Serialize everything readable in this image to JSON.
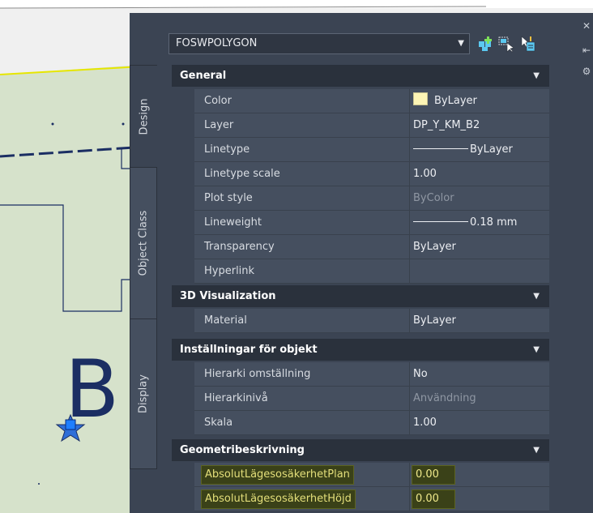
{
  "palette": {
    "object_type": "FOSWPOLYGON",
    "tabs": [
      {
        "label": "Design",
        "active": true
      },
      {
        "label": "Object Class",
        "active": false
      },
      {
        "label": "Display",
        "active": false
      }
    ],
    "toolbar_icons": [
      "quick-select-icon",
      "select-objects-icon",
      "toggle-pickadd-icon"
    ],
    "right_strip_icons": [
      "close-icon",
      "auto-hide-icon",
      "properties-icon"
    ]
  },
  "drawing": {
    "label": "B",
    "colors": {
      "fill": "#d6e2cb",
      "background": "#f0f0f0",
      "label": "#1b2e63",
      "accent_line": "#e6e600"
    }
  },
  "categories": [
    {
      "name": "General",
      "rows": [
        {
          "name": "Color",
          "value": "ByLayer",
          "kind": "color",
          "swatch": "#fdf5b5"
        },
        {
          "name": "Layer",
          "value": "DP_Y_KM_B2"
        },
        {
          "name": "Linetype",
          "value": "ByLayer",
          "kind": "linetype"
        },
        {
          "name": "Linetype scale",
          "value": "1.00"
        },
        {
          "name": "Plot style",
          "value": "ByColor",
          "dim": true
        },
        {
          "name": "Lineweight",
          "value": "0.18 mm",
          "kind": "linetype"
        },
        {
          "name": "Transparency",
          "value": "ByLayer"
        },
        {
          "name": "Hyperlink",
          "value": ""
        }
      ]
    },
    {
      "name": "3D Visualization",
      "rows": [
        {
          "name": "Material",
          "value": "ByLayer"
        }
      ]
    },
    {
      "name": "Inställningar för objekt",
      "rows": [
        {
          "name": "Hierarki omställning",
          "value": "No"
        },
        {
          "name": "Hierarkinivå",
          "value": "Användning",
          "dim": true
        },
        {
          "name": "Skala",
          "value": "1.00"
        }
      ]
    },
    {
      "name": "Geometribeskrivning",
      "rows": [
        {
          "name": "AbsolutLägesosäkerhetPlan",
          "value": "0.00",
          "highlight": true
        },
        {
          "name": "AbsolutLägesosäkerhetHöjd",
          "value": "0.00",
          "highlight": true
        }
      ]
    }
  ]
}
